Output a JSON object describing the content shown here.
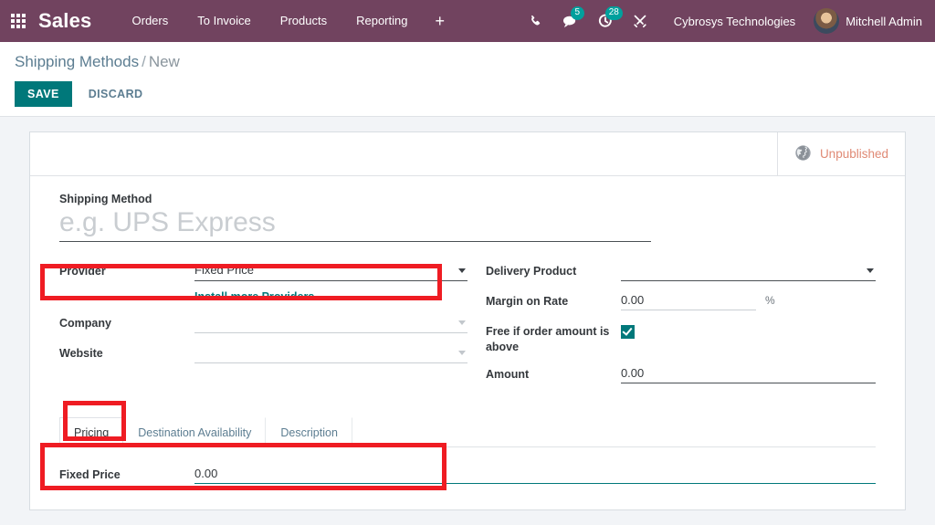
{
  "navbar": {
    "apps_icon": "apps-grid-icon",
    "brand": "Sales",
    "menu": [
      {
        "label": "Orders"
      },
      {
        "label": "To Invoice"
      },
      {
        "label": "Products"
      },
      {
        "label": "Reporting"
      }
    ],
    "add_label": "+",
    "systray": [
      {
        "icon": "phone-icon",
        "badge": ""
      },
      {
        "icon": "chat-bubble-icon",
        "badge": "5"
      },
      {
        "icon": "activity-clock-icon",
        "badge": "28"
      },
      {
        "icon": "tools-wrench-icon",
        "badge": ""
      }
    ],
    "company": "Cybrosys Technologies",
    "user": "Mitchell Admin",
    "avatar_icon": "user-avatar",
    "bg_color": "#71435f",
    "badge_color": "#00a09d"
  },
  "control_panel": {
    "breadcrumb_root": "Shipping Methods",
    "breadcrumb_separator": "/",
    "breadcrumb_current": "New",
    "save_label": "SAVE",
    "discard_label": "DISCARD",
    "save_color": "#00787a"
  },
  "statusbar": {
    "publish_label": "Unpublished",
    "publish_icon": "globe-icon",
    "publish_color": "#e08a75"
  },
  "form": {
    "title_label": "Shipping Method",
    "title_value": "",
    "title_placeholder": "e.g. UPS Express",
    "left": {
      "provider_label": "Provider",
      "provider_value": "Fixed Price",
      "install_link": "Install more Providers",
      "company_label": "Company",
      "company_value": "",
      "website_label": "Website",
      "website_value": ""
    },
    "right": {
      "delivery_product_label": "Delivery Product",
      "delivery_product_value": "",
      "margin_label": "Margin on Rate",
      "margin_value": "0.00",
      "margin_suffix": "%",
      "free_if_above_label": "Free if order amount is above",
      "free_if_above_checked": true,
      "amount_label": "Amount",
      "amount_value": "0.00"
    }
  },
  "notebook": {
    "tabs": [
      {
        "label": "Pricing",
        "active": true
      },
      {
        "label": "Destination Availability",
        "active": false
      },
      {
        "label": "Description",
        "active": false
      }
    ],
    "pricing": {
      "fixed_price_label": "Fixed Price",
      "fixed_price_value": "0.00"
    }
  },
  "annotations": {
    "highlight_color": "#ef1c23",
    "boxes": [
      {
        "name": "provider-highlight"
      },
      {
        "name": "pricing-tab-highlight"
      },
      {
        "name": "fixed-price-highlight"
      }
    ]
  }
}
